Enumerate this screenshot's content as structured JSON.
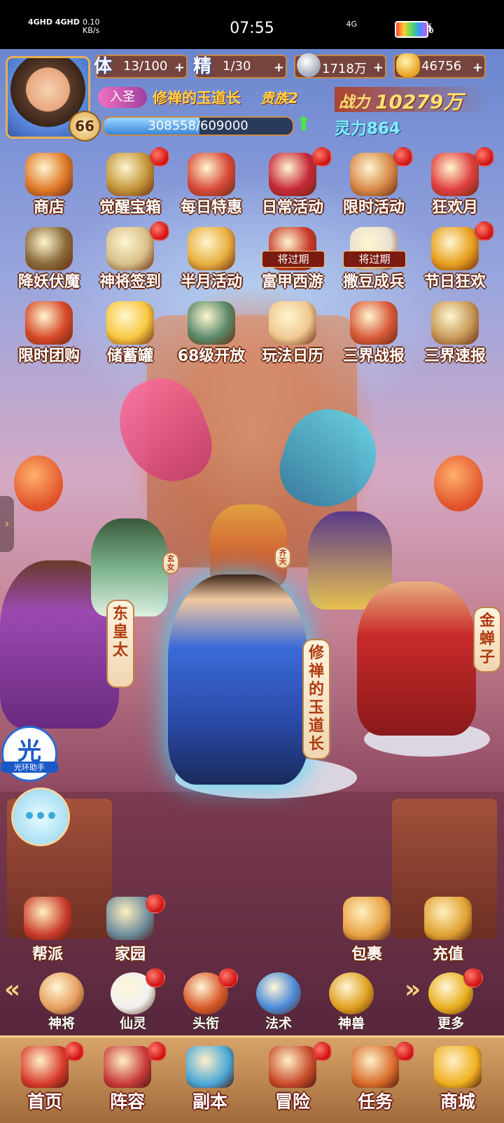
{
  "status_bar": {
    "network_left": "4GHD 4GHD",
    "speed": "0.10",
    "speed_unit": "KB/s",
    "time": "07:55",
    "signal": "4G",
    "battery": "89%"
  },
  "player": {
    "level": "66",
    "stamina_label": "体",
    "stamina": "13/100",
    "energy_label": "精",
    "energy": "1/30",
    "silver": "1718万",
    "gold": "46756",
    "rank_badge": "入圣",
    "title": "修禅的玉道长",
    "noble": "贵族2",
    "power_label": "战力",
    "power_value": "10279万",
    "exp_text": "308558/609000",
    "exp_fraction": 0.507,
    "spirit": "灵力864"
  },
  "activities": [
    {
      "label": "商店",
      "badge": false,
      "color": "#e07a2a"
    },
    {
      "label": "觉醒宝箱",
      "badge": true,
      "color": "#c4963a"
    },
    {
      "label": "每日特惠",
      "badge": false,
      "color": "#d84a3a"
    },
    {
      "label": "日常活动",
      "badge": true,
      "color": "#c8283a"
    },
    {
      "label": "限时活动",
      "badge": true,
      "color": "#d88a4a"
    },
    {
      "label": "狂欢月",
      "badge": true,
      "color": "#e04040"
    },
    {
      "label": "降妖伏魔",
      "badge": false,
      "color": "#8a6a3a"
    },
    {
      "label": "神将签到",
      "badge": true,
      "color": "#d8c08a"
    },
    {
      "label": "半月活动",
      "badge": false,
      "color": "#e8b040"
    },
    {
      "label": "富甲西游",
      "badge": false,
      "color": "#c83a2a",
      "expire": "将过期"
    },
    {
      "label": "撒豆成兵",
      "badge": false,
      "color": "#e8e0d0",
      "expire": "将过期"
    },
    {
      "label": "节日狂欢",
      "badge": true,
      "color": "#e8a020"
    },
    {
      "label": "限时团购",
      "badge": false,
      "color": "#d84a2a"
    },
    {
      "label": "储蓄罐",
      "badge": false,
      "color": "#f8c840"
    },
    {
      "label": "68级开放",
      "badge": false,
      "color": "#5a8a6a"
    },
    {
      "label": "玩法日历",
      "badge": false,
      "color": "#f0c890"
    },
    {
      "label": "三界战报",
      "badge": false,
      "color": "#d85a3a"
    },
    {
      "label": "三界速报",
      "badge": false,
      "color": "#c89a5a"
    }
  ],
  "characters": {
    "left_name": "东皇太",
    "left_small": "玄女",
    "center_small": "齐天",
    "center_name": "修禅的玉道长",
    "right_name": "金蝉子"
  },
  "side": {
    "assistant_glyph": "光",
    "assistant_label": "光环助手"
  },
  "base_buttons": [
    {
      "label": "帮派",
      "badge": false,
      "color": "#c83a2a"
    },
    {
      "label": "家园",
      "badge": true,
      "color": "#6a8a9a"
    },
    {
      "label": "包裹",
      "badge": false,
      "color": "#e8a040"
    },
    {
      "label": "充值",
      "badge": false,
      "color": "#e0a030"
    }
  ],
  "nav_icons": [
    {
      "label": "神将",
      "badge": false,
      "color": "#e8a060"
    },
    {
      "label": "仙灵",
      "badge": true,
      "color": "#f0f0f0"
    },
    {
      "label": "头衔",
      "badge": true,
      "color": "#d85a2a"
    },
    {
      "label": "法术",
      "badge": false,
      "color": "#4a8ad8"
    },
    {
      "label": "神兽",
      "badge": false,
      "color": "#e0a020"
    },
    {
      "label": "更多",
      "badge": true,
      "color": "#e8b020"
    }
  ],
  "arrows": {
    "left": "«",
    "right": "»"
  },
  "tabs": [
    {
      "label": "首页",
      "badge": true,
      "color": "#d83a2a"
    },
    {
      "label": "阵容",
      "badge": true,
      "color": "#c83a3a"
    },
    {
      "label": "副本",
      "badge": false,
      "color": "#4aa8d8"
    },
    {
      "label": "冒险",
      "badge": true,
      "color": "#c84a2a"
    },
    {
      "label": "任务",
      "badge": true,
      "color": "#d86a2a"
    },
    {
      "label": "商城",
      "badge": false,
      "color": "#f0b020"
    }
  ]
}
